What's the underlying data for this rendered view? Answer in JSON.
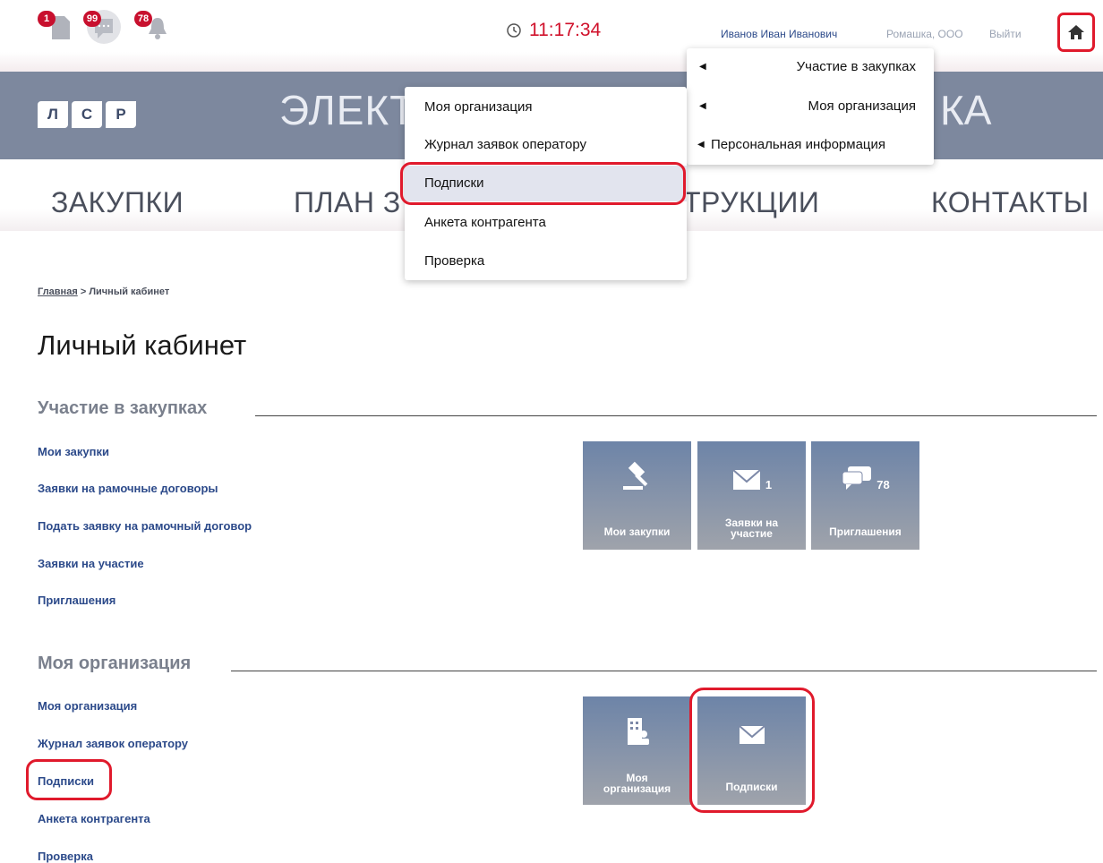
{
  "topbar": {
    "notifications": [
      {
        "icon": "document-icon",
        "count": "1"
      },
      {
        "icon": "chat-icon",
        "count": "99"
      },
      {
        "icon": "bell-icon",
        "count": "78"
      }
    ],
    "clock": "11:17:34",
    "user_name": "Иванов Иван Иванович",
    "org_name": "Ромашка, ООО",
    "logout": "Выйти"
  },
  "banner": {
    "logo_letters": [
      "Л",
      "С",
      "Р"
    ],
    "title_left": "ЭЛЕКТ",
    "title_right": "КА"
  },
  "nav": {
    "items": [
      "ЗАКУПКИ",
      "ПЛАН З",
      "ТРУКЦИИ",
      "КОНТАКТЫ"
    ]
  },
  "breadcrumb": {
    "home": "Главная",
    "sep": ">",
    "current": "Личный кабинет"
  },
  "page_title": "Личный кабинет",
  "sections": {
    "participation": {
      "title": "Участие в закупках",
      "links": [
        "Мои закупки",
        "Заявки на рамочные договоры",
        "Подать заявку на рамочный договор",
        "Заявки на участие",
        "Приглашения"
      ],
      "tiles": [
        {
          "icon": "gavel-icon",
          "count": "",
          "label": "Мои закупки"
        },
        {
          "icon": "envelope-icon",
          "count": "1",
          "label_line1": "Заявки на",
          "label_line2": "участие"
        },
        {
          "icon": "chat-bubbles-icon",
          "count": "78",
          "label": "Приглашения"
        }
      ]
    },
    "organization": {
      "title": "Моя организация",
      "links": [
        "Моя организация",
        "Журнал заявок оператору",
        "Подписки",
        "Анкета контрагента",
        "Проверка"
      ],
      "tiles": [
        {
          "icon": "building-user-icon",
          "label_line1": "Моя",
          "label_line2": "организация"
        },
        {
          "icon": "envelope-icon",
          "label": "Подписки"
        }
      ]
    }
  },
  "right_menu": {
    "items": [
      "Участие в закупках",
      "Моя организация",
      "Персональная информация"
    ]
  },
  "sub_menu": {
    "items": [
      "Моя организация",
      "Журнал заявок оператору",
      "Подписки",
      "Анкета контрагента",
      "Проверка"
    ]
  },
  "colors": {
    "accent_red": "#d0112b",
    "link_blue": "#2c4a8a",
    "banner": "#7d889e",
    "tile_top": "#6d84a8"
  }
}
